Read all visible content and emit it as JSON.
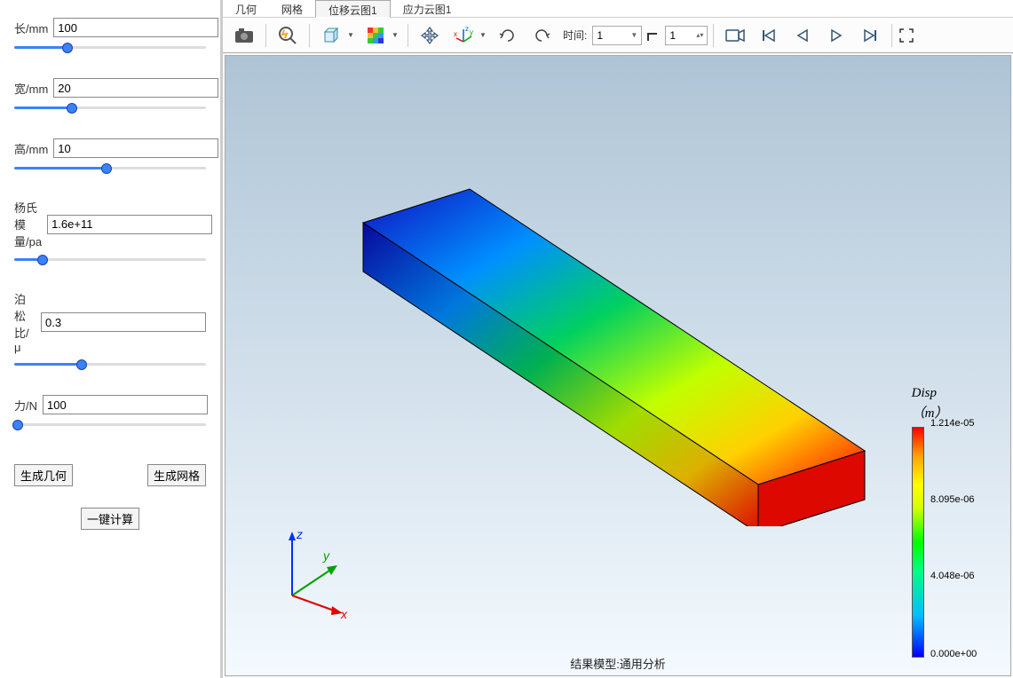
{
  "sidebar": {
    "params": [
      {
        "id": "length",
        "label": "长/mm",
        "value": "100",
        "pct": "28%"
      },
      {
        "id": "width",
        "label": "宽/mm",
        "value": "20",
        "pct": "30%"
      },
      {
        "id": "height",
        "label": "高/mm",
        "value": "10",
        "pct": "48%"
      },
      {
        "id": "youngs",
        "label": "杨氏模量/pa",
        "value": "1.6e+11",
        "pct": "15%"
      },
      {
        "id": "poisson",
        "label": "泊松比/μ",
        "value": "0.3",
        "pct": "35%"
      },
      {
        "id": "force",
        "label": "力/N",
        "value": "100",
        "pct": "2%"
      }
    ],
    "buttons": {
      "gen_geom": "生成几何",
      "gen_mesh": "生成网格",
      "compute": "一键计算"
    }
  },
  "tabs": [
    "几何",
    "网格",
    "位移云图1",
    "应力云图1"
  ],
  "active_tab_index": 2,
  "toolbar": {
    "time_label": "时间:",
    "time_value": "1",
    "frame_value": "1"
  },
  "legend": {
    "title_l1": "Disp",
    "title_l2": "（m）",
    "ticks": [
      {
        "pos": "0%",
        "text": "1.214e-05"
      },
      {
        "pos": "33%",
        "text": "8.095e-06"
      },
      {
        "pos": "66%",
        "text": "4.048e-06"
      },
      {
        "pos": "100%",
        "text": "0.000e+00"
      }
    ]
  },
  "bottom_text": "结果模型:通用分析",
  "triad": {
    "x": "x",
    "y": "y",
    "z": "z"
  },
  "chart_data": {
    "type": "contour3d",
    "title": "Disp （m）",
    "quantity": "Displacement magnitude",
    "unit": "m",
    "colormap": "jet",
    "geometry": {
      "shape": "rectangular_beam",
      "L_mm": 100,
      "W_mm": 20,
      "H_mm": 10
    },
    "range": [
      0.0,
      1.214e-05
    ],
    "ticks": [
      0.0,
      4.048e-06,
      8.095e-06,
      1.214e-05
    ],
    "note": "Color varies approximately linearly along the beam length from 0 at one end to max at the other (cantilever tip displacement)."
  }
}
